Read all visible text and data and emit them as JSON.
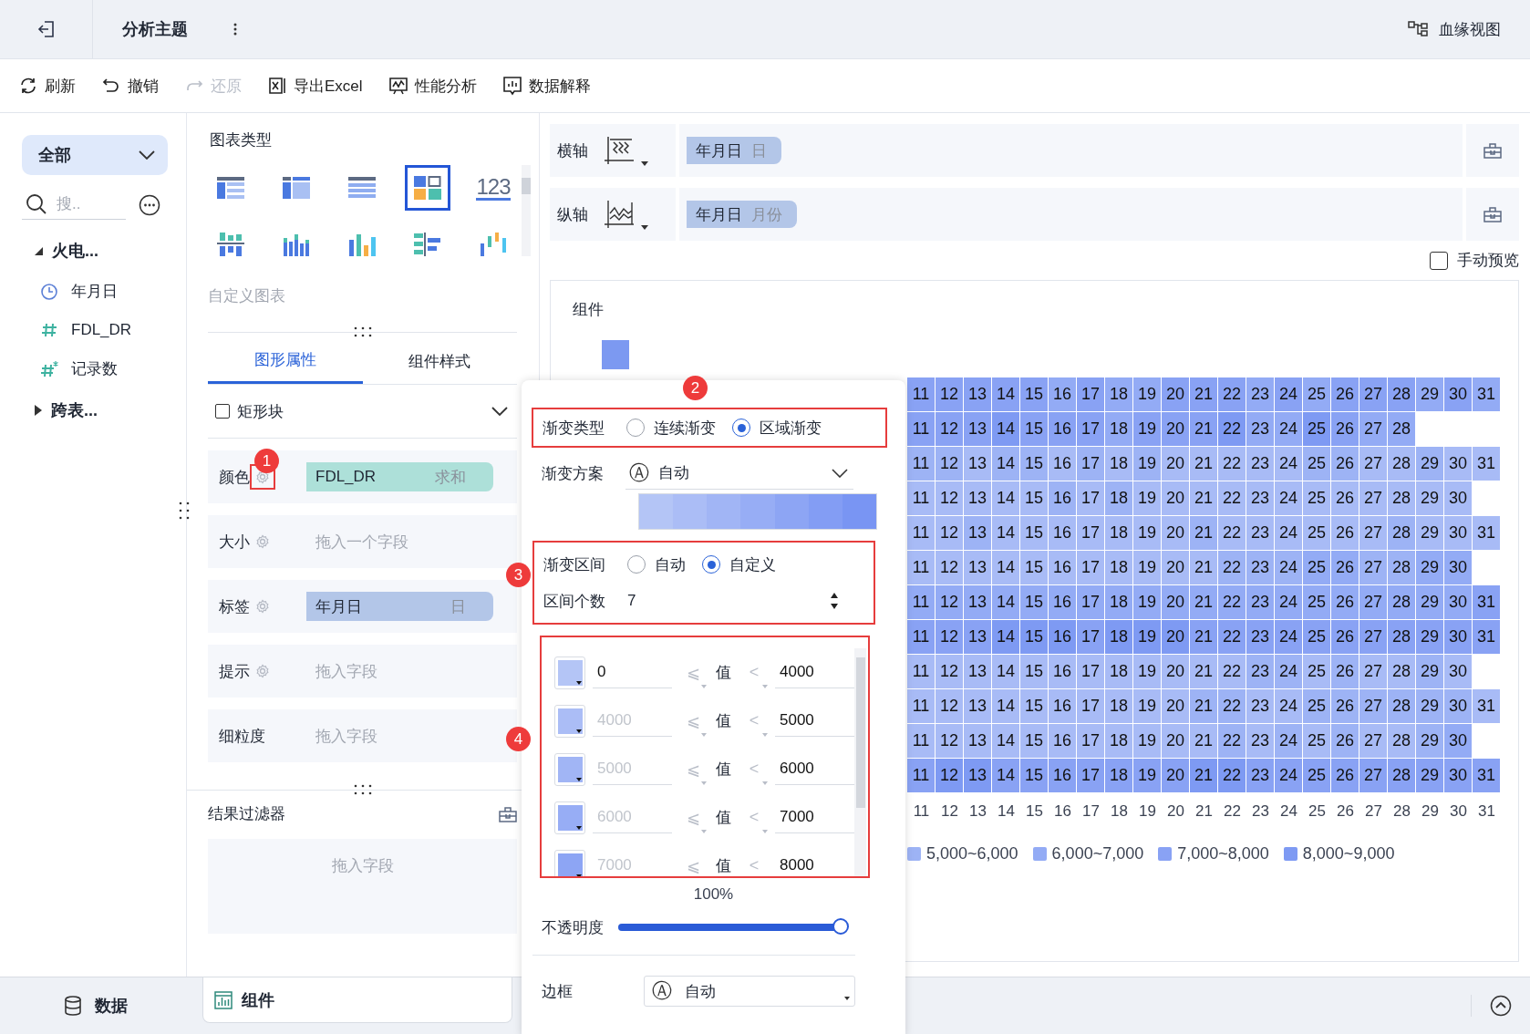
{
  "topbar": {
    "title": "分析主题",
    "lineage": "血缘视图"
  },
  "toolbar": [
    {
      "kind": "refresh",
      "label": "刷新",
      "disabled": false
    },
    {
      "kind": "undo",
      "label": "撤销",
      "disabled": false
    },
    {
      "kind": "redo",
      "label": "还原",
      "disabled": true
    },
    {
      "kind": "export",
      "label": "导出Excel",
      "disabled": false
    },
    {
      "kind": "perf",
      "label": "性能分析",
      "disabled": false
    },
    {
      "kind": "explain",
      "label": "数据解释",
      "disabled": false
    }
  ],
  "sidebar": {
    "scope": "全部",
    "search_placeholder": "搜..",
    "tree": [
      {
        "label": "火电...",
        "expanded": true,
        "children": [
          {
            "kind": "date",
            "label": "年月日"
          },
          {
            "kind": "number",
            "label": "FDL_DR"
          },
          {
            "kind": "calc",
            "label": "记录数"
          }
        ]
      },
      {
        "label": "跨表...",
        "expanded": false
      }
    ]
  },
  "chart_panel": {
    "title": "图表类型",
    "types": [
      {
        "kind": "table",
        "selected": false
      },
      {
        "kind": "cross",
        "selected": false
      },
      {
        "kind": "detail",
        "selected": false
      },
      {
        "kind": "heatmap",
        "selected": true
      },
      {
        "kind": "kpi",
        "label": "123",
        "selected": false
      },
      {
        "kind": "grouped",
        "selected": false
      },
      {
        "kind": "stacked",
        "selected": false
      },
      {
        "kind": "bar",
        "selected": false
      },
      {
        "kind": "hbar",
        "selected": false
      },
      {
        "kind": "waterfall",
        "selected": false
      }
    ],
    "custom": "自定义图表",
    "tabs": [
      {
        "label": "图形属性",
        "selected": true
      },
      {
        "label": "组件样式",
        "selected": false
      }
    ],
    "mark": {
      "label": "矩形块",
      "checked": false
    },
    "fields": [
      {
        "label": "颜色",
        "gear": true,
        "highlighted": true,
        "pill": {
          "kind": "measure",
          "name": "FDL_DR",
          "agg": "求和"
        }
      },
      {
        "label": "大小",
        "gear": true,
        "highlighted": false,
        "placeholder": "拖入一个字段"
      },
      {
        "label": "标签",
        "gear": true,
        "highlighted": false,
        "pill": {
          "kind": "dimension",
          "name": "年月日",
          "agg": "日"
        }
      },
      {
        "label": "提示",
        "gear": true,
        "highlighted": false,
        "placeholder": "拖入字段"
      },
      {
        "label": "细粒度",
        "gear": false,
        "placeholder": "拖入字段"
      }
    ],
    "filter": {
      "title": "结果过滤器",
      "placeholder": "拖入字段"
    }
  },
  "axes": [
    {
      "kind": "x",
      "label": "横轴",
      "field": "年月日",
      "unit": "日"
    },
    {
      "kind": "y",
      "label": "纵轴",
      "field": "年月日",
      "unit": "月份"
    }
  ],
  "manual_preview": {
    "label": "手动预览",
    "checked": false
  },
  "chart": {
    "title": "组件",
    "rows": [
      {
        "cells": [
          {
            "day": "11",
            "color": "#89a2f4"
          },
          {
            "day": "12",
            "color": "#89a2f4"
          },
          {
            "day": "13",
            "color": "#89a2f4"
          },
          {
            "day": "14",
            "color": "#89a2f4"
          },
          {
            "day": "15",
            "color": "#89a2f4"
          },
          {
            "day": "16",
            "color": "#93abf5"
          },
          {
            "day": "17",
            "color": "#89a2f4"
          },
          {
            "day": "18",
            "color": "#93abf5"
          },
          {
            "day": "19",
            "color": "#93abf5"
          },
          {
            "day": "20",
            "color": "#89a2f4"
          },
          {
            "day": "21",
            "color": "#89a2f4"
          },
          {
            "day": "22",
            "color": "#89a2f4"
          },
          {
            "day": "23",
            "color": "#93abf5"
          },
          {
            "day": "24",
            "color": "#89a2f4"
          },
          {
            "day": "25",
            "color": "#93abf5"
          },
          {
            "day": "26",
            "color": "#89a2f4"
          },
          {
            "day": "27",
            "color": "#89a2f4"
          },
          {
            "day": "28",
            "color": "#89a2f4"
          },
          {
            "day": "29",
            "color": "#93abf5"
          },
          {
            "day": "30",
            "color": "#89a2f4"
          },
          {
            "day": "31",
            "color": "#93abf5"
          }
        ]
      },
      {
        "cells": [
          {
            "day": "11",
            "color": "#89a2f4"
          },
          {
            "day": "12",
            "color": "#89a2f4"
          },
          {
            "day": "13",
            "color": "#89a2f4"
          },
          {
            "day": "14",
            "color": "#7e9af3"
          },
          {
            "day": "15",
            "color": "#89a2f4"
          },
          {
            "day": "16",
            "color": "#89a2f4"
          },
          {
            "day": "17",
            "color": "#89a2f4"
          },
          {
            "day": "18",
            "color": "#93abf5"
          },
          {
            "day": "19",
            "color": "#89a2f4"
          },
          {
            "day": "20",
            "color": "#89a2f4"
          },
          {
            "day": "21",
            "color": "#89a2f4"
          },
          {
            "day": "22",
            "color": "#7e9af3"
          },
          {
            "day": "23",
            "color": "#93abf5"
          },
          {
            "day": "24",
            "color": "#93abf5"
          },
          {
            "day": "25",
            "color": "#7e9af3"
          },
          {
            "day": "26",
            "color": "#89a2f4"
          },
          {
            "day": "27",
            "color": "#93abf5"
          },
          {
            "day": "28",
            "color": "#93abf5"
          }
        ]
      },
      {
        "cells": [
          {
            "day": "11",
            "color": "#9db3f5"
          },
          {
            "day": "12",
            "color": "#9db3f5"
          },
          {
            "day": "13",
            "color": "#a8bbf6"
          },
          {
            "day": "14",
            "color": "#9db3f5"
          },
          {
            "day": "15",
            "color": "#9db3f5"
          },
          {
            "day": "16",
            "color": "#a8bbf6"
          },
          {
            "day": "17",
            "color": "#9db3f5"
          },
          {
            "day": "18",
            "color": "#a8bbf6"
          },
          {
            "day": "19",
            "color": "#9db3f5"
          },
          {
            "day": "20",
            "color": "#a8bbf6"
          },
          {
            "day": "21",
            "color": "#a8bbf6"
          },
          {
            "day": "22",
            "color": "#a8bbf6"
          },
          {
            "day": "23",
            "color": "#a8bbf6"
          },
          {
            "day": "24",
            "color": "#a8bbf6"
          },
          {
            "day": "25",
            "color": "#9db3f5"
          },
          {
            "day": "26",
            "color": "#9db3f5"
          },
          {
            "day": "27",
            "color": "#a8bbf6"
          },
          {
            "day": "28",
            "color": "#a8bbf6"
          },
          {
            "day": "29",
            "color": "#9db3f5"
          },
          {
            "day": "30",
            "color": "#a8bbf6"
          },
          {
            "day": "31",
            "color": "#a8bbf6"
          }
        ]
      },
      {
        "cells": [
          {
            "day": "11",
            "color": "#a8bbf6"
          },
          {
            "day": "12",
            "color": "#a8bbf6"
          },
          {
            "day": "13",
            "color": "#a8bbf6"
          },
          {
            "day": "14",
            "color": "#a8bbf6"
          },
          {
            "day": "15",
            "color": "#a8bbf6"
          },
          {
            "day": "16",
            "color": "#9db3f5"
          },
          {
            "day": "17",
            "color": "#a8bbf6"
          },
          {
            "day": "18",
            "color": "#9db3f5"
          },
          {
            "day": "19",
            "color": "#a8bbf6"
          },
          {
            "day": "20",
            "color": "#a8bbf6"
          },
          {
            "day": "21",
            "color": "#a8bbf6"
          },
          {
            "day": "22",
            "color": "#a8bbf6"
          },
          {
            "day": "23",
            "color": "#a8bbf6"
          },
          {
            "day": "24",
            "color": "#a8bbf6"
          },
          {
            "day": "25",
            "color": "#a8bbf6"
          },
          {
            "day": "26",
            "color": "#a8bbf6"
          },
          {
            "day": "27",
            "color": "#a8bbf6"
          },
          {
            "day": "28",
            "color": "#a8bbf6"
          },
          {
            "day": "29",
            "color": "#a8bbf6"
          },
          {
            "day": "30",
            "color": "#a8bbf6"
          }
        ]
      },
      {
        "cells": [
          {
            "day": "11",
            "color": "#a8bbf6"
          },
          {
            "day": "12",
            "color": "#a8bbf6"
          },
          {
            "day": "13",
            "color": "#9db3f5"
          },
          {
            "day": "14",
            "color": "#a8bbf6"
          },
          {
            "day": "15",
            "color": "#a8bbf6"
          },
          {
            "day": "16",
            "color": "#a8bbf6"
          },
          {
            "day": "17",
            "color": "#a8bbf6"
          },
          {
            "day": "18",
            "color": "#a8bbf6"
          },
          {
            "day": "19",
            "color": "#a8bbf6"
          },
          {
            "day": "20",
            "color": "#a8bbf6"
          },
          {
            "day": "21",
            "color": "#9db3f5"
          },
          {
            "day": "22",
            "color": "#a8bbf6"
          },
          {
            "day": "23",
            "color": "#a8bbf6"
          },
          {
            "day": "24",
            "color": "#a8bbf6"
          },
          {
            "day": "25",
            "color": "#a8bbf6"
          },
          {
            "day": "26",
            "color": "#a8bbf6"
          },
          {
            "day": "27",
            "color": "#a8bbf6"
          },
          {
            "day": "28",
            "color": "#9db3f5"
          },
          {
            "day": "29",
            "color": "#a8bbf6"
          },
          {
            "day": "30",
            "color": "#a8bbf6"
          },
          {
            "day": "31",
            "color": "#a8bbf6"
          }
        ]
      },
      {
        "cells": [
          {
            "day": "11",
            "color": "#a8bbf6"
          },
          {
            "day": "12",
            "color": "#a8bbf6"
          },
          {
            "day": "13",
            "color": "#a8bbf6"
          },
          {
            "day": "14",
            "color": "#a8bbf6"
          },
          {
            "day": "15",
            "color": "#a8bbf6"
          },
          {
            "day": "16",
            "color": "#a8bbf6"
          },
          {
            "day": "17",
            "color": "#a8bbf6"
          },
          {
            "day": "18",
            "color": "#a8bbf6"
          },
          {
            "day": "19",
            "color": "#a8bbf6"
          },
          {
            "day": "20",
            "color": "#a8bbf6"
          },
          {
            "day": "21",
            "color": "#a8bbf6"
          },
          {
            "day": "22",
            "color": "#9db3f5"
          },
          {
            "day": "23",
            "color": "#9db3f5"
          },
          {
            "day": "24",
            "color": "#9db3f5"
          },
          {
            "day": "25",
            "color": "#93abf5"
          },
          {
            "day": "26",
            "color": "#93abf5"
          },
          {
            "day": "27",
            "color": "#9db3f5"
          },
          {
            "day": "28",
            "color": "#9db3f5"
          },
          {
            "day": "29",
            "color": "#93abf5"
          },
          {
            "day": "30",
            "color": "#93abf5"
          }
        ]
      },
      {
        "cells": [
          {
            "day": "11",
            "color": "#93abf5"
          },
          {
            "day": "12",
            "color": "#93abf5"
          },
          {
            "day": "13",
            "color": "#93abf5"
          },
          {
            "day": "14",
            "color": "#93abf5"
          },
          {
            "day": "15",
            "color": "#93abf5"
          },
          {
            "day": "16",
            "color": "#93abf5"
          },
          {
            "day": "17",
            "color": "#93abf5"
          },
          {
            "day": "18",
            "color": "#93abf5"
          },
          {
            "day": "19",
            "color": "#93abf5"
          },
          {
            "day": "20",
            "color": "#93abf5"
          },
          {
            "day": "21",
            "color": "#93abf5"
          },
          {
            "day": "22",
            "color": "#93abf5"
          },
          {
            "day": "23",
            "color": "#93abf5"
          },
          {
            "day": "24",
            "color": "#93abf5"
          },
          {
            "day": "25",
            "color": "#93abf5"
          },
          {
            "day": "26",
            "color": "#93abf5"
          },
          {
            "day": "27",
            "color": "#93abf5"
          },
          {
            "day": "28",
            "color": "#93abf5"
          },
          {
            "day": "29",
            "color": "#93abf5"
          },
          {
            "day": "30",
            "color": "#93abf5"
          },
          {
            "day": "31",
            "color": "#89a2f4"
          }
        ]
      },
      {
        "cells": [
          {
            "day": "11",
            "color": "#89a2f4"
          },
          {
            "day": "12",
            "color": "#89a2f4"
          },
          {
            "day": "13",
            "color": "#89a2f4"
          },
          {
            "day": "14",
            "color": "#7e9af3"
          },
          {
            "day": "15",
            "color": "#7e9af3"
          },
          {
            "day": "16",
            "color": "#7e9af3"
          },
          {
            "day": "17",
            "color": "#89a2f4"
          },
          {
            "day": "18",
            "color": "#7e9af3"
          },
          {
            "day": "19",
            "color": "#7e9af3"
          },
          {
            "day": "20",
            "color": "#7e9af3"
          },
          {
            "day": "21",
            "color": "#89a2f4"
          },
          {
            "day": "22",
            "color": "#89a2f4"
          },
          {
            "day": "23",
            "color": "#89a2f4"
          },
          {
            "day": "24",
            "color": "#89a2f4"
          },
          {
            "day": "25",
            "color": "#89a2f4"
          },
          {
            "day": "26",
            "color": "#89a2f4"
          },
          {
            "day": "27",
            "color": "#89a2f4"
          },
          {
            "day": "28",
            "color": "#89a2f4"
          },
          {
            "day": "29",
            "color": "#89a2f4"
          },
          {
            "day": "30",
            "color": "#89a2f4"
          },
          {
            "day": "31",
            "color": "#89a2f4"
          }
        ]
      },
      {
        "cells": [
          {
            "day": "11",
            "color": "#a8bbf6"
          },
          {
            "day": "12",
            "color": "#a8bbf6"
          },
          {
            "day": "13",
            "color": "#a8bbf6"
          },
          {
            "day": "14",
            "color": "#a8bbf6"
          },
          {
            "day": "15",
            "color": "#a8bbf6"
          },
          {
            "day": "16",
            "color": "#a8bbf6"
          },
          {
            "day": "17",
            "color": "#a8bbf6"
          },
          {
            "day": "18",
            "color": "#a8bbf6"
          },
          {
            "day": "19",
            "color": "#a8bbf6"
          },
          {
            "day": "20",
            "color": "#a8bbf6"
          },
          {
            "day": "21",
            "color": "#a8bbf6"
          },
          {
            "day": "22",
            "color": "#a8bbf6"
          },
          {
            "day": "23",
            "color": "#9db3f5"
          },
          {
            "day": "24",
            "color": "#9db3f5"
          },
          {
            "day": "25",
            "color": "#a8bbf6"
          },
          {
            "day": "26",
            "color": "#9db3f5"
          },
          {
            "day": "27",
            "color": "#a8bbf6"
          },
          {
            "day": "28",
            "color": "#a8bbf6"
          },
          {
            "day": "29",
            "color": "#9db3f5"
          },
          {
            "day": "30",
            "color": "#a8bbf6"
          }
        ]
      },
      {
        "cells": [
          {
            "day": "11",
            "color": "#a8bbf6"
          },
          {
            "day": "12",
            "color": "#a8bbf6"
          },
          {
            "day": "13",
            "color": "#a8bbf6"
          },
          {
            "day": "14",
            "color": "#a8bbf6"
          },
          {
            "day": "15",
            "color": "#a8bbf6"
          },
          {
            "day": "16",
            "color": "#a8bbf6"
          },
          {
            "day": "17",
            "color": "#a8bbf6"
          },
          {
            "day": "18",
            "color": "#a8bbf6"
          },
          {
            "day": "19",
            "color": "#a8bbf6"
          },
          {
            "day": "20",
            "color": "#a8bbf6"
          },
          {
            "day": "21",
            "color": "#9db3f5"
          },
          {
            "day": "22",
            "color": "#9db3f5"
          },
          {
            "day": "23",
            "color": "#a8bbf6"
          },
          {
            "day": "24",
            "color": "#a8bbf6"
          },
          {
            "day": "25",
            "color": "#9db3f5"
          },
          {
            "day": "26",
            "color": "#9db3f5"
          },
          {
            "day": "27",
            "color": "#9db3f5"
          },
          {
            "day": "28",
            "color": "#9db3f5"
          },
          {
            "day": "29",
            "color": "#9db3f5"
          },
          {
            "day": "30",
            "color": "#9db3f5"
          },
          {
            "day": "31",
            "color": "#a8bbf6"
          }
        ]
      },
      {
        "cells": [
          {
            "day": "11",
            "color": "#a8bbf6"
          },
          {
            "day": "12",
            "color": "#a8bbf6"
          },
          {
            "day": "13",
            "color": "#a8bbf6"
          },
          {
            "day": "14",
            "color": "#a8bbf6"
          },
          {
            "day": "15",
            "color": "#a8bbf6"
          },
          {
            "day": "16",
            "color": "#a8bbf6"
          },
          {
            "day": "17",
            "color": "#a8bbf6"
          },
          {
            "day": "18",
            "color": "#a8bbf6"
          },
          {
            "day": "19",
            "color": "#a8bbf6"
          },
          {
            "day": "20",
            "color": "#a8bbf6"
          },
          {
            "day": "21",
            "color": "#a8bbf6"
          },
          {
            "day": "22",
            "color": "#9db3f5"
          },
          {
            "day": "23",
            "color": "#a8bbf6"
          },
          {
            "day": "24",
            "color": "#9db3f5"
          },
          {
            "day": "25",
            "color": "#a8bbf6"
          },
          {
            "day": "26",
            "color": "#9db3f5"
          },
          {
            "day": "27",
            "color": "#a8bbf6"
          },
          {
            "day": "28",
            "color": "#a8bbf6"
          },
          {
            "day": "29",
            "color": "#9db3f5"
          },
          {
            "day": "30",
            "color": "#93abf5"
          }
        ]
      },
      {
        "cells": [
          {
            "day": "11",
            "color": "#89a2f4"
          },
          {
            "day": "12",
            "color": "#7e9af3"
          },
          {
            "day": "13",
            "color": "#7e9af3"
          },
          {
            "day": "14",
            "color": "#89a2f4"
          },
          {
            "day": "15",
            "color": "#89a2f4"
          },
          {
            "day": "16",
            "color": "#89a2f4"
          },
          {
            "day": "17",
            "color": "#89a2f4"
          },
          {
            "day": "18",
            "color": "#89a2f4"
          },
          {
            "day": "19",
            "color": "#89a2f4"
          },
          {
            "day": "20",
            "color": "#89a2f4"
          },
          {
            "day": "21",
            "color": "#7e9af3"
          },
          {
            "day": "22",
            "color": "#7e9af3"
          },
          {
            "day": "23",
            "color": "#89a2f4"
          },
          {
            "day": "24",
            "color": "#89a2f4"
          },
          {
            "day": "25",
            "color": "#89a2f4"
          },
          {
            "day": "26",
            "color": "#89a2f4"
          },
          {
            "day": "27",
            "color": "#89a2f4"
          },
          {
            "day": "28",
            "color": "#89a2f4"
          },
          {
            "day": "29",
            "color": "#89a2f4"
          },
          {
            "day": "30",
            "color": "#89a2f4"
          },
          {
            "day": "31",
            "color": "#89a2f4"
          }
        ]
      }
    ],
    "x_labels": [
      "11",
      "12",
      "13",
      "14",
      "15",
      "16",
      "17",
      "18",
      "19",
      "20",
      "21",
      "22",
      "23",
      "24",
      "25",
      "26",
      "27",
      "28",
      "29",
      "30",
      "31"
    ],
    "legend": [
      {
        "label": "5,000~6,000",
        "color": "#9db3f5"
      },
      {
        "label": "6,000~7,000",
        "color": "#93abf5"
      },
      {
        "label": "7,000~8,000",
        "color": "#89a2f4"
      },
      {
        "label": "8,000~9,000",
        "color": "#7e9af3"
      }
    ]
  },
  "bottom_tabs": [
    {
      "kind": "data",
      "label": "数据",
      "selected": false
    },
    {
      "kind": "component",
      "label": "组件",
      "selected": true
    }
  ],
  "popup": {
    "gradient_type": {
      "label": "渐变类型",
      "highlighted": true,
      "options": [
        {
          "label": "连续渐变",
          "selected": false
        },
        {
          "label": "区域渐变",
          "selected": true
        }
      ]
    },
    "gradient_scheme": {
      "label": "渐变方案",
      "icon": "Ⓐ",
      "value": "自动",
      "swatches": [
        {
          "color": "#b4c5f6"
        },
        {
          "color": "#abbdf6"
        },
        {
          "color": "#a1b5f5"
        },
        {
          "color": "#97adf5"
        },
        {
          "color": "#8da5f4"
        },
        {
          "color": "#839df4"
        },
        {
          "color": "#7995f3"
        }
      ]
    },
    "gradient_range": {
      "highlighted": true,
      "label": "渐变区间",
      "options": [
        {
          "label": "自动",
          "selected": false
        },
        {
          "label": "自定义",
          "selected": true
        }
      ],
      "count_label": "区间个数",
      "count": "7"
    },
    "intervals": {
      "highlighted": true,
      "rows": [
        {
          "color": "#b4c5f6",
          "from": "0",
          "from_disabled": false,
          "op_low": "⩽",
          "label": "值",
          "op_high": "<",
          "to": "4000"
        },
        {
          "color": "#abbdf6",
          "from": "4000",
          "from_disabled": true,
          "op_low": "⩽",
          "label": "值",
          "op_high": "<",
          "to": "5000"
        },
        {
          "color": "#a1b5f5",
          "from": "5000",
          "from_disabled": true,
          "op_low": "⩽",
          "label": "值",
          "op_high": "<",
          "to": "6000"
        },
        {
          "color": "#97adf5",
          "from": "6000",
          "from_disabled": true,
          "op_low": "⩽",
          "label": "值",
          "op_high": "<",
          "to": "7000"
        },
        {
          "color": "#8da5f4",
          "from": "7000",
          "from_disabled": true,
          "op_low": "⩽",
          "label": "值",
          "op_high": "<",
          "to": "8000"
        }
      ]
    },
    "opacity": {
      "reading": "100%",
      "label": "不透明度",
      "level": 1
    },
    "border": {
      "label": "边框",
      "icon": "Ⓐ",
      "value": "自动"
    }
  },
  "annotations": [
    {
      "number": "1"
    },
    {
      "number": "2"
    },
    {
      "number": "3"
    },
    {
      "number": "4"
    }
  ]
}
